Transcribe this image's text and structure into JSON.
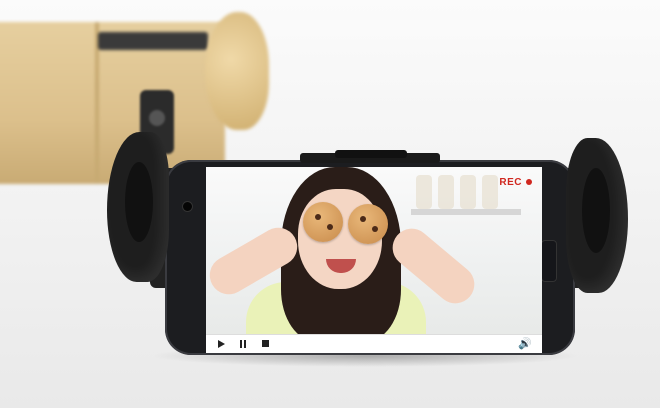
{
  "video": {
    "rec_label": "REC",
    "controls": {
      "play_icon": "play-icon",
      "pause_icon": "pause-icon",
      "stop_icon": "stop-icon",
      "volume_icon": "volume-icon"
    }
  },
  "colors": {
    "rec_red": "#d0271f",
    "phone_body": "#1c1d20",
    "background_phone_gold": "#dcc08c"
  }
}
